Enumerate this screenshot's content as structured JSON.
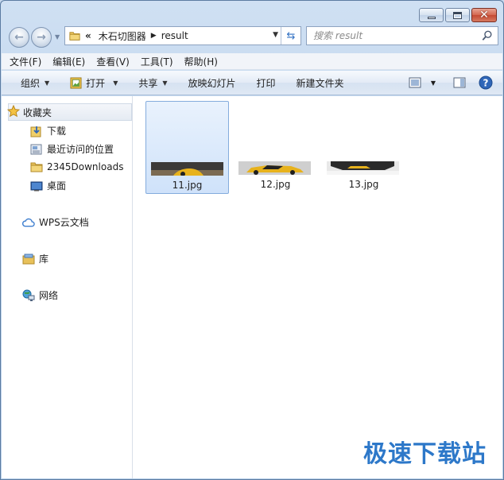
{
  "address": {
    "overflow": "«",
    "crumbs": [
      "木石切图器",
      "result"
    ]
  },
  "search": {
    "placeholder": "搜索 result"
  },
  "menu": [
    "文件(F)",
    "编辑(E)",
    "查看(V)",
    "工具(T)",
    "帮助(H)"
  ],
  "toolbar": {
    "organize": "组织",
    "open": "打开",
    "share": "共享",
    "slideshow": "放映幻灯片",
    "print": "打印",
    "new_folder": "新建文件夹"
  },
  "nav": {
    "favorites": "收藏夹",
    "downloads": "下载",
    "recent": "最近访问的位置",
    "downloads2345": "2345Downloads",
    "desktop": "桌面",
    "wps": "WPS云文档",
    "library": "库",
    "network": "网络"
  },
  "files": [
    {
      "name": "11.jpg",
      "selected": true
    },
    {
      "name": "12.jpg",
      "selected": false
    },
    {
      "name": "13.jpg",
      "selected": false
    }
  ],
  "watermark": "极速下载站",
  "colors": {
    "accent": "#2d78c9",
    "selection": "#cfe2fa",
    "car": "#e7b21c"
  }
}
